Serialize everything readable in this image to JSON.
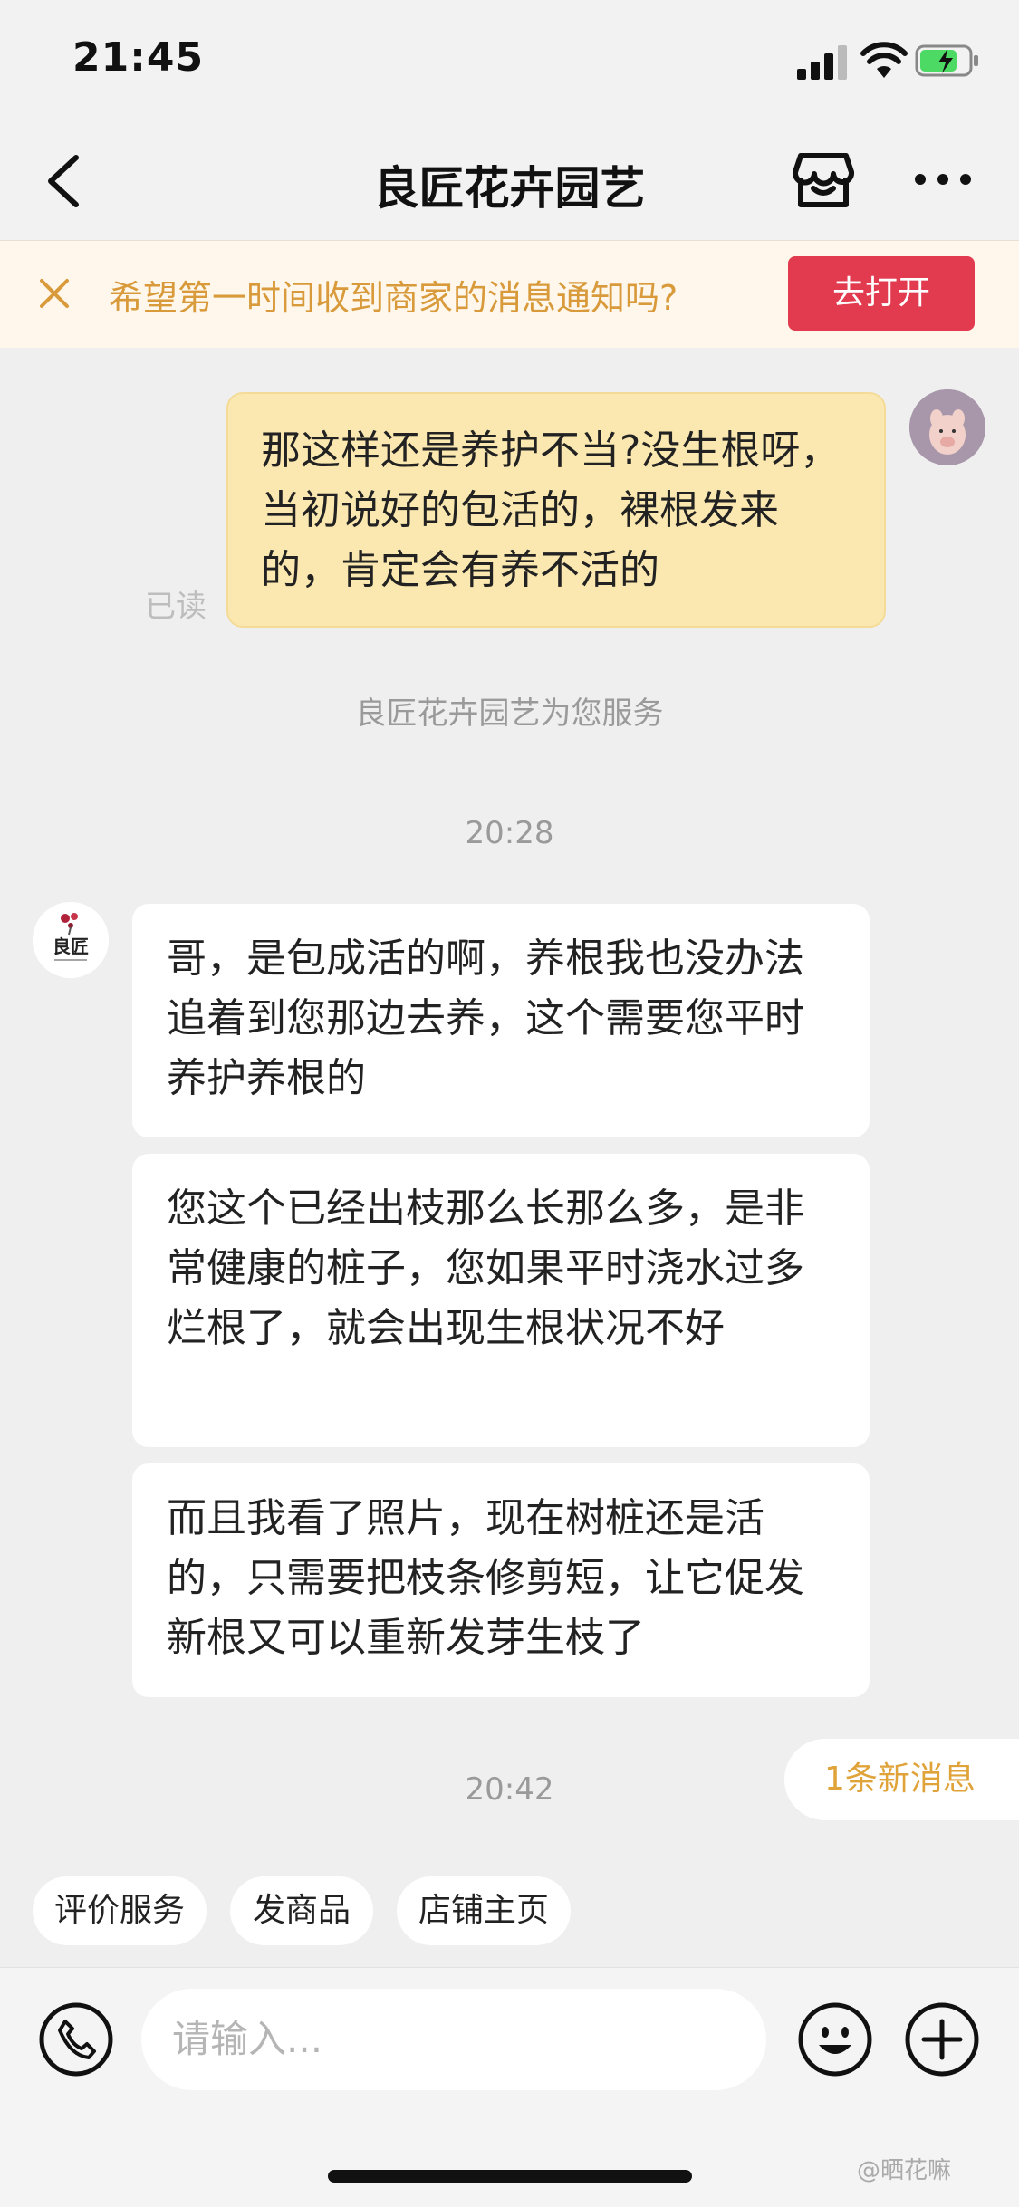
{
  "status": {
    "time": "21:45"
  },
  "nav": {
    "title": "良匠花卉园艺"
  },
  "banner": {
    "text": "希望第一时间收到商家的消息通知吗?",
    "button": "去打开"
  },
  "messages": {
    "outgoing": "那这样还是养护不当?没生根呀，当初说好的包活的，裸根发来的，肯定会有养不活的",
    "read_label": "已读",
    "system": "良匠花卉园艺为您服务",
    "time1": "20:28",
    "incoming": [
      "哥，是包成活的啊，养根我也没办法追着到您那边去养，这个需要您平时养护养根的",
      "您这个已经出枝那么长那么多，是非常健康的桩子，您如果平时浇水过多烂根了，就会出现生根状况不好",
      "而且我看了照片，现在树桩还是活的，只需要把枝条修剪短，让它促发新根又可以重新发芽生枝了"
    ],
    "time2": "20:42",
    "new_messages": "1条新消息",
    "shop_avatar_text": "良匠"
  },
  "quick_actions": [
    "评价服务",
    "发商品",
    "店铺主页"
  ],
  "input": {
    "placeholder": "请输入..."
  },
  "watermark": "@晒花嘛",
  "colors": {
    "accent_red": "#e23a4e",
    "bubble_out": "#fbe8b0",
    "banner_text": "#d89a3a"
  }
}
